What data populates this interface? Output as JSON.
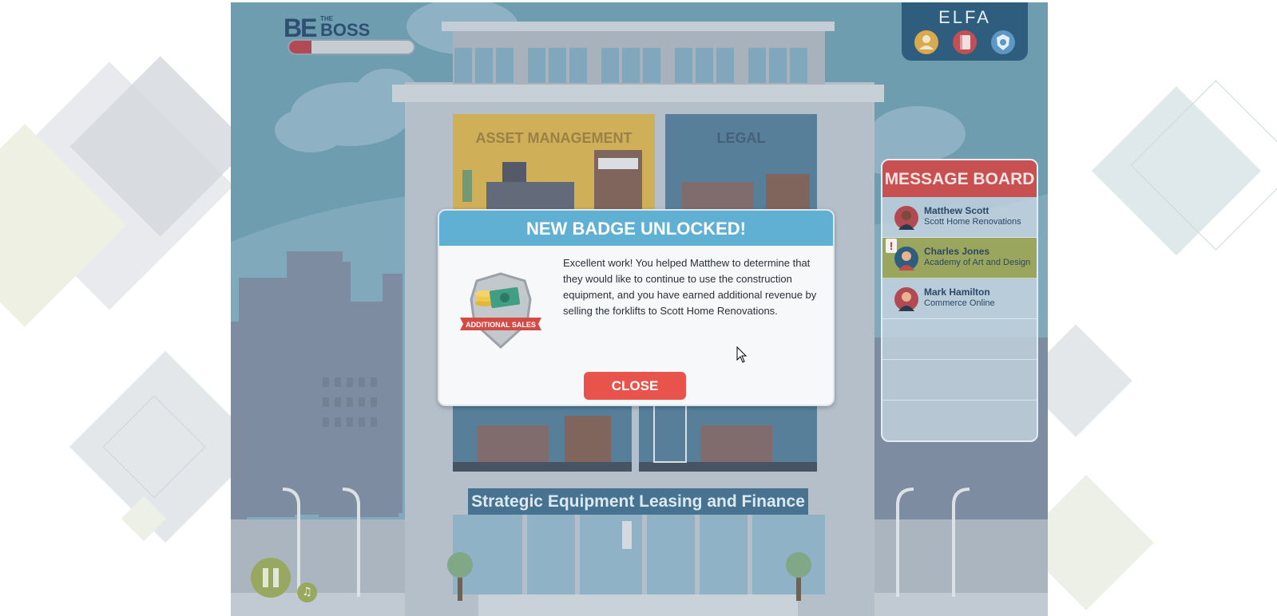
{
  "game": {
    "logo": {
      "initials": "BE",
      "the": "THE",
      "name": "BOSS"
    },
    "progress": 0.18,
    "brand": "ELFA",
    "nav_icons": [
      "profile-icon",
      "notebook-icon",
      "badge-shield-icon"
    ],
    "rooms": {
      "asset_management": "ASSET MANAGEMENT",
      "legal": "LEGAL"
    },
    "building_sign": "Strategic Equipment Leasing and Finance",
    "controls": {
      "pause_icon": "pause-icon",
      "mute_icon": "music-muted-icon"
    }
  },
  "message_board": {
    "title": "MESSAGE BOARD",
    "alert_symbol": "!",
    "messages": [
      {
        "name": "Matthew Scott",
        "company": "Scott Home Renovations",
        "active": false
      },
      {
        "name": "Charles Jones",
        "company": "Academy of Art and Design",
        "active": true
      },
      {
        "name": "Mark Hamilton",
        "company": "Commerce Online",
        "active": false
      }
    ]
  },
  "modal": {
    "title": "NEW BADGE UNLOCKED!",
    "badge_label": "ADDITIONAL SALES",
    "text": "Excellent work! You helped Matthew to determine that they would like to continue to use the construction equipment, and you have earned additional revenue by selling the forklifts to Scott Home Renovations.",
    "close_label": "CLOSE"
  },
  "colors": {
    "sky": "#5a8fa5",
    "header_blue": "#5fb0d2",
    "close_red": "#e8534b",
    "board_red": "#c95050",
    "active_row": "#9aa55e"
  }
}
